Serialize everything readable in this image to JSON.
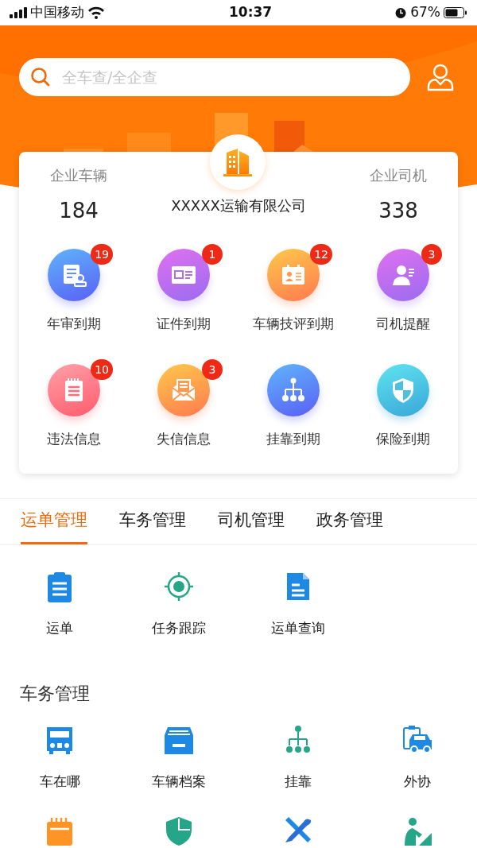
{
  "status_bar": {
    "carrier": "中国移动",
    "time": "10:37",
    "battery": "67%"
  },
  "search": {
    "placeholder": "全车查/全企查"
  },
  "company": {
    "name": "XXXXX运输有限公司",
    "stats": [
      {
        "label": "企业车辆",
        "value": "184"
      },
      {
        "label": "企业司机",
        "value": "338"
      }
    ]
  },
  "alerts": [
    {
      "label": "年审到期",
      "badge": "19"
    },
    {
      "label": "证件到期",
      "badge": "1"
    },
    {
      "label": "车辆技评到期",
      "badge": "12"
    },
    {
      "label": "司机提醒",
      "badge": "3"
    },
    {
      "label": "违法信息",
      "badge": "10"
    },
    {
      "label": "失信信息",
      "badge": "3"
    },
    {
      "label": "挂靠到期"
    },
    {
      "label": "保险到期"
    }
  ],
  "tabs": [
    {
      "label": "运单管理",
      "selected": true
    },
    {
      "label": "车务管理",
      "selected": false
    },
    {
      "label": "司机管理",
      "selected": false
    },
    {
      "label": "政务管理",
      "selected": false
    }
  ],
  "sections": [
    {
      "items": [
        {
          "label": "运单"
        },
        {
          "label": "任务跟踪"
        },
        {
          "label": "运单查询"
        }
      ]
    },
    {
      "title": "车务管理",
      "items": [
        {
          "kind": "tile",
          "label": "车在哪"
        },
        {
          "kind": "tile",
          "label": "车辆档案"
        },
        {
          "kind": "tile",
          "label": "挂靠"
        },
        {
          "kind": "tile",
          "label": "外协"
        },
        {
          "kind": "icon"
        },
        {
          "kind": "icon"
        },
        {
          "kind": "icon"
        },
        {
          "kind": "icon"
        }
      ]
    }
  ]
}
